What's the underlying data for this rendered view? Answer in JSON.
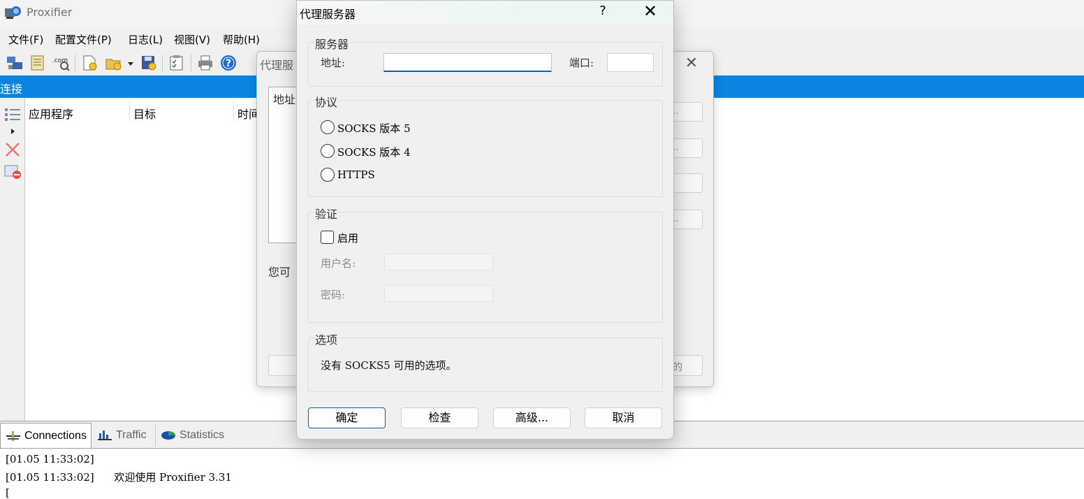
{
  "app": {
    "title": "Proxifier"
  },
  "menu": [
    "文件(F)",
    "配置文件(P)",
    "日志(L)",
    "视图(V)",
    "帮助(H)"
  ],
  "toolbar_icons": [
    "proxy-servers-icon",
    "proxification-rules-icon",
    "name-resolution-icon",
    "new-profile-icon",
    "open-profile-icon",
    "dropdown-arrow-icon",
    "save-profile-icon",
    "options-icon",
    "print-icon",
    "help-icon"
  ],
  "connections_panel": {
    "title": "连接",
    "columns": [
      "应用程序",
      "目标",
      "时间"
    ]
  },
  "tabs": [
    {
      "label": "Connections",
      "icon": "connections-icon",
      "active": true
    },
    {
      "label": "Traffic",
      "icon": "traffic-chart-icon",
      "active": false
    },
    {
      "label": "Statistics",
      "icon": "statistics-pie-icon",
      "active": false
    }
  ],
  "log_lines": [
    "[01.05 11:33:02]",
    "[01.05 11:33:02]      欢迎使用 Proxifier 3.31"
  ],
  "bg_dialog": {
    "title": "代理服",
    "list_header": "地址",
    "buttons": [
      "..",
      "..",
      "",
      ".."
    ],
    "note": "您可",
    "right_button": "的"
  },
  "dialog": {
    "title": "代理服务器",
    "help_label": "?",
    "close_label": "✕",
    "server_group": {
      "title": "服务器",
      "address_label": "地址:",
      "address_value": "",
      "port_label": "端口:",
      "port_value": ""
    },
    "protocol_group": {
      "title": "协议",
      "options": [
        "SOCKS 版本 5",
        "SOCKS 版本 4",
        "HTTPS"
      ],
      "selected": null
    },
    "auth_group": {
      "title": "验证",
      "enable_label": "启用",
      "enabled": false,
      "username_label": "用户名:",
      "password_label": "密码:"
    },
    "options_group": {
      "title": "选项",
      "text": "没有 SOCKS5 可用的选项。"
    },
    "buttons": {
      "ok": "确定",
      "check": "检查",
      "advanced": "高级...",
      "cancel": "取消"
    }
  }
}
